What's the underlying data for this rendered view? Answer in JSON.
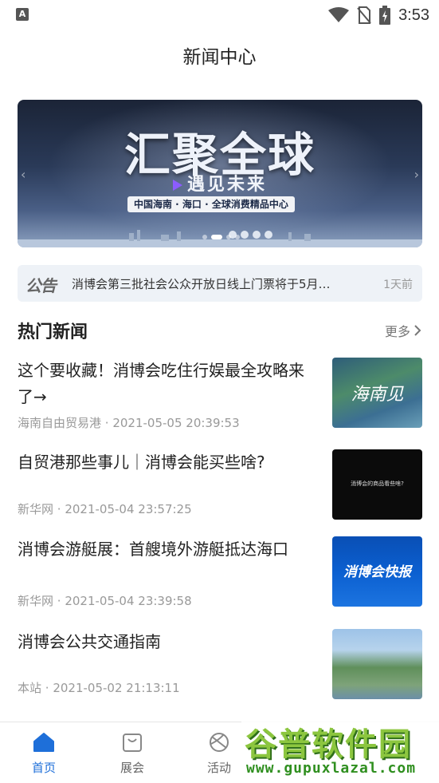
{
  "status_bar": {
    "time": "3:53",
    "app_icon_letter": "A",
    "icons": [
      "wifi-icon",
      "no-sim-icon",
      "battery-charging-icon"
    ]
  },
  "header": {
    "title": "新闻中心"
  },
  "banner": {
    "title": "汇聚全球",
    "subtitle": "遇见未来",
    "tagline": "中国海南 · 海口 · 全球消费精品中心"
  },
  "notice": {
    "label": "公告",
    "text": "消博会第三批社会公众开放日线上门票将于5月…",
    "time": "1天前"
  },
  "section": {
    "title": "热门新闻",
    "more_label": "更多"
  },
  "news": [
    {
      "title": "这个要收藏！消博会吃住行娱最全攻略来了→",
      "source": "海南自由贸易港",
      "datetime": "2021-05-05 20:39:53",
      "thumb_text": "海南见"
    },
    {
      "title": "自贸港那些事儿｜消博会能买些啥?",
      "source": "新华网",
      "datetime": "2021-05-04 23:57:25",
      "thumb_text": "消博会的商品看些啥?"
    },
    {
      "title": "消博会游艇展：首艘境外游艇抵达海口",
      "source": "新华网",
      "datetime": "2021-05-04 23:39:58",
      "thumb_text": "消博会快报"
    },
    {
      "title": "消博会公共交通指南",
      "source": "本站",
      "datetime": "2021-05-02 21:13:11",
      "thumb_text": ""
    }
  ],
  "bottom_nav": [
    {
      "label": "首页",
      "icon": "home-icon",
      "active": true
    },
    {
      "label": "展会",
      "icon": "bag-icon",
      "active": false
    },
    {
      "label": "活动",
      "icon": "ball-icon",
      "active": false
    }
  ],
  "watermark": {
    "text": "谷普软件园",
    "url": "www.gupuxlazal.com"
  },
  "colors": {
    "accent": "#1e6fd9",
    "notice_bg": "#eef2f7",
    "meta_gray": "#999999"
  }
}
